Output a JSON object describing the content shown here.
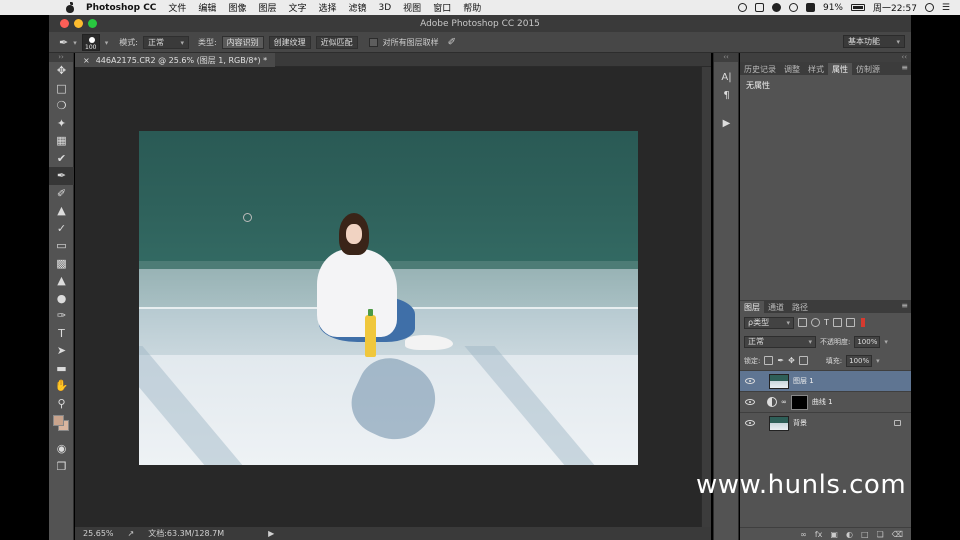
{
  "menubar": {
    "app_name": "Photoshop CC",
    "items": [
      "文件",
      "编辑",
      "图像",
      "图层",
      "文字",
      "选择",
      "滤镜",
      "3D",
      "视图",
      "窗口",
      "帮助"
    ],
    "battery": "91%",
    "clock": "周一22:57"
  },
  "window": {
    "title": "Adobe Photoshop CC 2015"
  },
  "options": {
    "brush_size": "100",
    "mode_label": "模式:",
    "mode_value": "正常",
    "type_label": "类型:",
    "type_options": [
      "内容识别",
      "创建纹理",
      "近似匹配"
    ],
    "sample_all_label": "对所有图层取样",
    "workspace": "基本功能"
  },
  "document": {
    "tab_label": "446A2175.CR2 @ 25.6% (图层 1, RGB/8*) *",
    "zoom": "25.65%",
    "doc_size": "文档:63.3M/128.7M"
  },
  "panels": {
    "top_tabs": [
      "历史记录",
      "调整",
      "样式",
      "属性",
      "仿制源"
    ],
    "top_active": "属性",
    "properties_text": "无属性",
    "layer_tabs": [
      "图层",
      "通道",
      "路径"
    ],
    "filter_kind": "ρ类型",
    "blend_mode": "正常",
    "opacity_label": "不透明度:",
    "opacity_value": "100%",
    "lock_label": "锁定:",
    "fill_label": "填充:",
    "fill_value": "100%",
    "layers": [
      {
        "name": "图层 1",
        "selected": true
      },
      {
        "name": "曲线 1",
        "selected": false
      },
      {
        "name": "背景",
        "selected": false
      }
    ]
  },
  "watermark": "www.hunls.com"
}
